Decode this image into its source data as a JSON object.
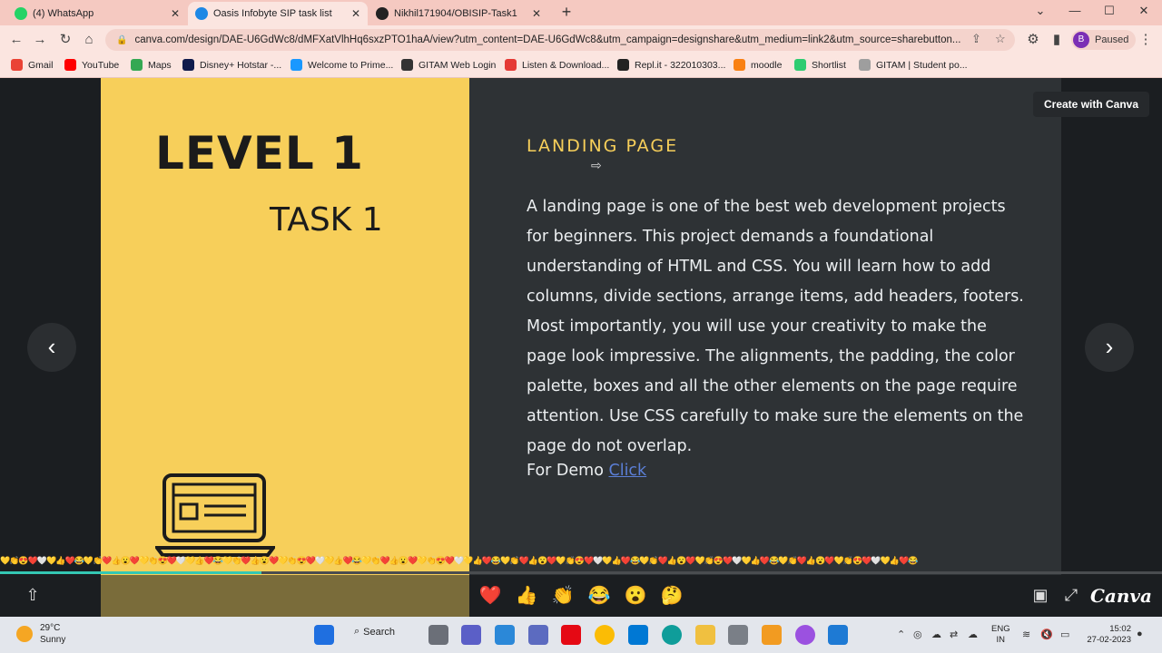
{
  "browser": {
    "tabs": [
      {
        "label": "(4) WhatsApp",
        "color": "#25d366"
      },
      {
        "label": "Oasis Infobyte SIP task list",
        "color": "#1e88e5"
      },
      {
        "label": "Nikhil171904/OBISIP-Task1",
        "color": "#222222"
      }
    ],
    "url": "canva.com/design/DAE-U6GdWc8/dMFXatVlhHq6sxzPTO1haA/view?utm_content=DAE-U6GdWc8&utm_campaign=designshare&utm_medium=link2&utm_source=sharebutton...",
    "profile_initial": "B",
    "profile_status": "Paused",
    "bookmarks": [
      {
        "label": "Gmail",
        "color": "#ea4335"
      },
      {
        "label": "YouTube",
        "color": "#ff0000"
      },
      {
        "label": "Maps",
        "color": "#34a853"
      },
      {
        "label": "Disney+ Hotstar -...",
        "color": "#0f1b4c"
      },
      {
        "label": "Welcome to Prime...",
        "color": "#1a98ff"
      },
      {
        "label": "GITAM Web Login",
        "color": "#333333"
      },
      {
        "label": "Listen & Download...",
        "color": "#e53935"
      },
      {
        "label": "Repl.it - 322010303...",
        "color": "#222222"
      },
      {
        "label": "moodle",
        "color": "#f98012"
      },
      {
        "label": "Shortlist",
        "color": "#2ecc71"
      },
      {
        "label": "GITAM | Student po...",
        "color": "#9e9e9e"
      }
    ]
  },
  "slide": {
    "level": "LEVEL 1",
    "task": "TASK 1",
    "title": "LANDING PAGE",
    "body": "A landing page is one of the best web development projects for beginners. This project demands a foundational understanding of HTML and CSS. You will learn how to add columns, divide sections, arrange items, add headers, footers. Most importantly, you will use your creativity to make the page look impressive. The alignments, the padding, the color palette, boxes and all the other elements on the page require attention. Use CSS carefully to make sure the elements on the page do not overlap.",
    "demo_label": "For Demo",
    "demo_link": "Click"
  },
  "viewer": {
    "create_button": "Create with Canva",
    "prev_label": "‹",
    "next_label": "›",
    "progress_fraction": 0.225,
    "reactions": [
      "❤️",
      "👍",
      "👏",
      "😂",
      "😮",
      "🤔"
    ],
    "brand": "Canva",
    "emoji_strip": "💛👏😍❤️🤍💛👍❤️😂💛👏❤️👍😮❤️💛👏😍❤️🤍💛👍❤️😂💛👏❤️👍😮❤️💛👏😍❤️🤍💛👍❤️😂💛👏❤️👍😮❤️💛👏😍❤️🤍💛👍❤️😂💛👏❤️👍😮❤️💛👏😍❤️🤍💛👍❤️😂💛👏❤️👍😮❤️💛👏😍❤️🤍💛👍❤️😂💛👏❤️👍😮❤️💛👏😍❤️🤍💛👍❤️😂"
  },
  "taskbar": {
    "temperature": "29°C",
    "condition": "Sunny",
    "search_label": "Search",
    "lang_top": "ENG",
    "lang_bottom": "IN",
    "time": "15:02",
    "date": "27-02-2023"
  }
}
